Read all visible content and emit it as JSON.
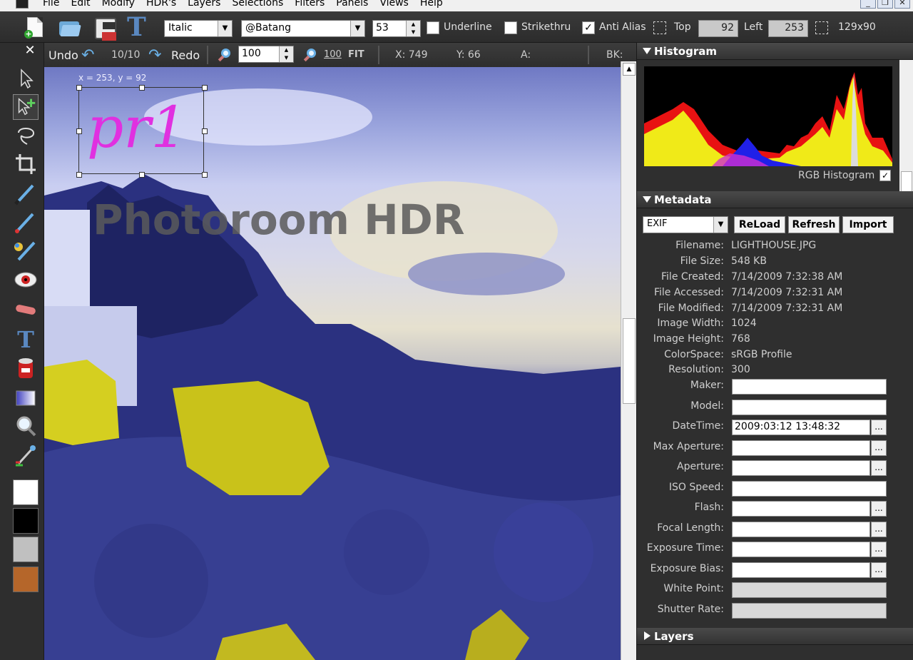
{
  "menu": {
    "items": [
      "File",
      "Edit",
      "Modify",
      "HDR's",
      "Layers",
      "Selections",
      "Filters",
      "Panels",
      "Views",
      "Help"
    ],
    "window_controls": [
      "_",
      "❐",
      "✕"
    ]
  },
  "toolbar": {
    "text_tool_glyph": "T",
    "font_style": "Italic",
    "font_name": "@Batang",
    "font_size": "53",
    "underline_label": "Underline",
    "underline_checked": "",
    "strikethru_label": "Strikethru",
    "strikethru_checked": "",
    "antialias_label": "Anti Alias",
    "antialias_checked": "✓",
    "top_label": "Top",
    "top_value": "92",
    "left_label": "Left",
    "left_value": "253",
    "size_value": "129x90"
  },
  "toolbar2": {
    "undo_label": "Undo",
    "undo_count": "10/10",
    "redo_label": "Redo",
    "zoom_value": "100",
    "zoom100_label": "100",
    "fit_label": "FIT",
    "x_readout": "X: 749",
    "y_readout": "Y: 66",
    "a_label": "A:",
    "bk_label": "BK:"
  },
  "left_tools": {
    "close_label": "✕",
    "text_glyph": "T",
    "colors": {
      "swatch1": "#ffffff",
      "swatch2": "#000000",
      "swatch3": "#c0c0c0",
      "swatch4": "#b5662a"
    }
  },
  "canvas": {
    "coord_tag": "x = 253, y = 92",
    "text_layer": "pr1",
    "watermark": "Photoroom HDR"
  },
  "histogram": {
    "title": "Histogram",
    "label": "RGB Histogram",
    "checked": "✓"
  },
  "metadata": {
    "title": "Metadata",
    "format": "EXIF",
    "buttons": [
      "ReLoad",
      "Refresh",
      "Import"
    ],
    "info": [
      {
        "label": "Filename:",
        "value": "LIGHTHOUSE.JPG"
      },
      {
        "label": "File Size:",
        "value": "548 KB"
      },
      {
        "label": "File Created:",
        "value": "7/14/2009 7:32:38 AM"
      },
      {
        "label": "File Accessed:",
        "value": "7/14/2009 7:32:31 AM"
      },
      {
        "label": "File Modified:",
        "value": "7/14/2009 7:32:31 AM"
      },
      {
        "label": "Image Width:",
        "value": "1024"
      },
      {
        "label": "Image Height:",
        "value": "768"
      },
      {
        "label": "ColorSpace:",
        "value": "sRGB Profile"
      },
      {
        "label": "Resolution:",
        "value": "300"
      }
    ],
    "fields": [
      {
        "label": "Maker:",
        "value": ""
      },
      {
        "label": "Model:",
        "value": ""
      },
      {
        "label": "DateTime:",
        "value": "2009:03:12 13:48:32"
      },
      {
        "label": "Max Aperture:",
        "value": ""
      },
      {
        "label": "Aperture:",
        "value": ""
      },
      {
        "label": "ISO Speed:",
        "value": ""
      },
      {
        "label": "Flash:",
        "value": ""
      },
      {
        "label": "Focal Length:",
        "value": ""
      },
      {
        "label": "Exposure Time:",
        "value": ""
      },
      {
        "label": "Exposure Bias:",
        "value": ""
      },
      {
        "label": "White Point:",
        "value": ""
      },
      {
        "label": "Shutter Rate:",
        "value": ""
      }
    ],
    "dots_label": "..."
  },
  "layers": {
    "title": "Layers"
  }
}
